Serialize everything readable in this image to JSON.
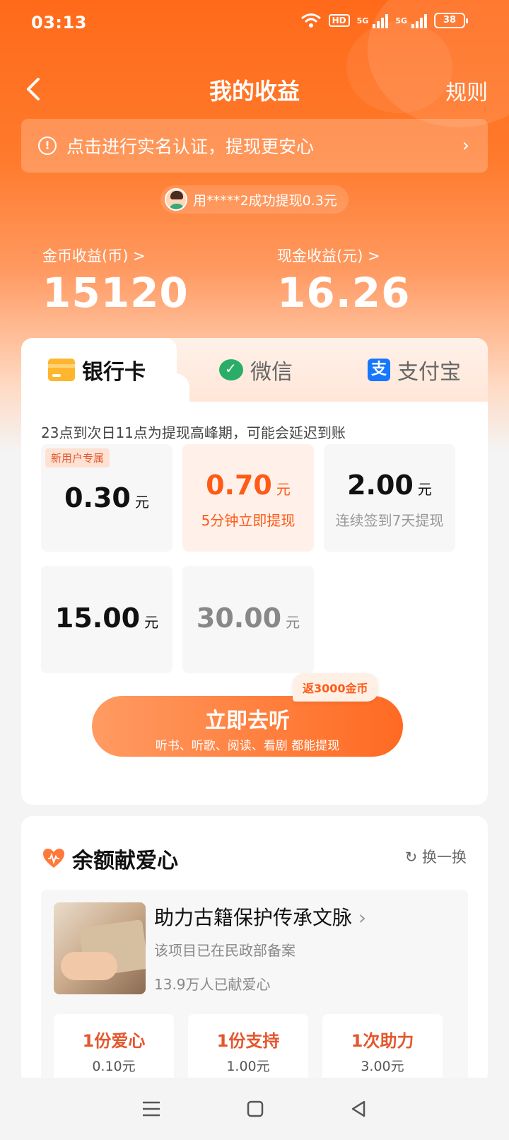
{
  "status_bar": {
    "time": "03:13",
    "hd": "HD",
    "net1": "5G",
    "net2": "5G",
    "battery": "38"
  },
  "nav": {
    "title": "我的收益",
    "rules": "规则"
  },
  "banner": {
    "text": "点击进行实名认证，提现更安心"
  },
  "ticker": {
    "text": "用*****2成功提现0.3元"
  },
  "earnings": {
    "coin_label": "金币收益(币) >",
    "coin_value": "15120",
    "cash_label": "现金收益(元) >",
    "cash_value": "16.26"
  },
  "tabs": [
    {
      "label": "银行卡",
      "icon": "bank-card-icon"
    },
    {
      "label": "微信",
      "icon": "wechat-icon"
    },
    {
      "label": "支付宝",
      "icon": "alipay-icon"
    }
  ],
  "notice": "23点到次日11点为提现高峰期，可能会延迟到账",
  "amounts": [
    {
      "tag": "新用户专属",
      "value": "0.30",
      "unit": "元",
      "sub": ""
    },
    {
      "tag": "",
      "value": "0.70",
      "unit": "元",
      "sub": "5分钟立即提现"
    },
    {
      "tag": "",
      "value": "2.00",
      "unit": "元",
      "sub": "连续签到7天提现"
    },
    {
      "tag": "",
      "value": "15.00",
      "unit": "元",
      "sub": ""
    },
    {
      "tag": "",
      "value": "30.00",
      "unit": "元",
      "sub": ""
    }
  ],
  "cta": {
    "label": "立即去听",
    "sub": "听书、听歌、阅读、看剧 都能提现",
    "badge": "返3000金币"
  },
  "charity": {
    "title": "余额献爱心",
    "refresh": "换一换",
    "project_title": "助力古籍保护传承文脉",
    "project_desc": "该项目已在民政部备案",
    "project_count": "13.9万人已献爱心",
    "options": [
      {
        "label": "1份爱心",
        "price": "0.10元"
      },
      {
        "label": "1份支持",
        "price": "1.00元"
      },
      {
        "label": "1次助力",
        "price": "3.00元"
      }
    ]
  },
  "colors": {
    "brand": "#ff6a1a",
    "accent_text": "#ff5a16"
  }
}
